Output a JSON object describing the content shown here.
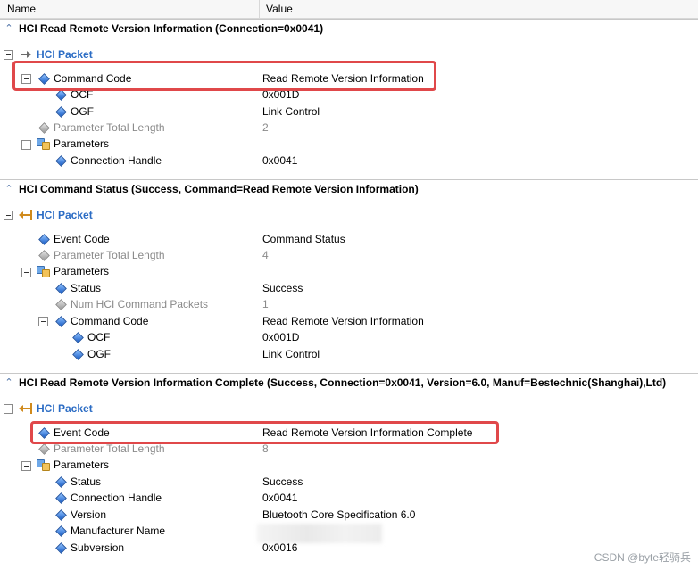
{
  "columns": {
    "name": "Name",
    "value": "Value"
  },
  "sections": [
    {
      "title": "HCI Read Remote Version Information (Connection=0x0041)",
      "packet": "HCI Packet",
      "rows": [
        {
          "label": "Command Code",
          "value": "Read Remote Version Information"
        },
        {
          "label": "OCF",
          "value": "0x001D"
        },
        {
          "label": "OGF",
          "value": "Link Control"
        },
        {
          "label": "Parameter Total Length",
          "value": "2"
        },
        {
          "label": "Parameters",
          "value": ""
        },
        {
          "label": "Connection Handle",
          "value": "0x0041"
        }
      ]
    },
    {
      "title": "HCI Command Status (Success, Command=Read Remote Version Information)",
      "packet": "HCI Packet",
      "rows": [
        {
          "label": "Event Code",
          "value": "Command Status"
        },
        {
          "label": "Parameter Total Length",
          "value": "4"
        },
        {
          "label": "Parameters",
          "value": ""
        },
        {
          "label": "Status",
          "value": "Success"
        },
        {
          "label": "Num HCI Command Packets",
          "value": "1"
        },
        {
          "label": "Command Code",
          "value": "Read Remote Version Information"
        },
        {
          "label": "OCF",
          "value": "0x001D"
        },
        {
          "label": "OGF",
          "value": "Link Control"
        }
      ]
    },
    {
      "title": "HCI Read Remote Version Information Complete (Success, Connection=0x0041, Version=6.0, Manuf=Bestechnic(Shanghai),Ltd)",
      "packet": "HCI Packet",
      "rows": [
        {
          "label": "Event Code",
          "value": "Read Remote Version Information Complete"
        },
        {
          "label": "Parameter Total Length",
          "value": "8"
        },
        {
          "label": "Parameters",
          "value": ""
        },
        {
          "label": "Status",
          "value": "Success"
        },
        {
          "label": "Connection Handle",
          "value": "0x0041"
        },
        {
          "label": "Version",
          "value": "Bluetooth Core Specification 6.0"
        },
        {
          "label": "Manufacturer Name",
          "value": ""
        },
        {
          "label": "Subversion",
          "value": "0x0016"
        }
      ]
    }
  ],
  "watermark": "CSDN @byte轻骑兵",
  "colors": {
    "highlight": "#e0484a",
    "packet_title": "#2b6cc4",
    "disabled_text": "#8a8a8a"
  }
}
